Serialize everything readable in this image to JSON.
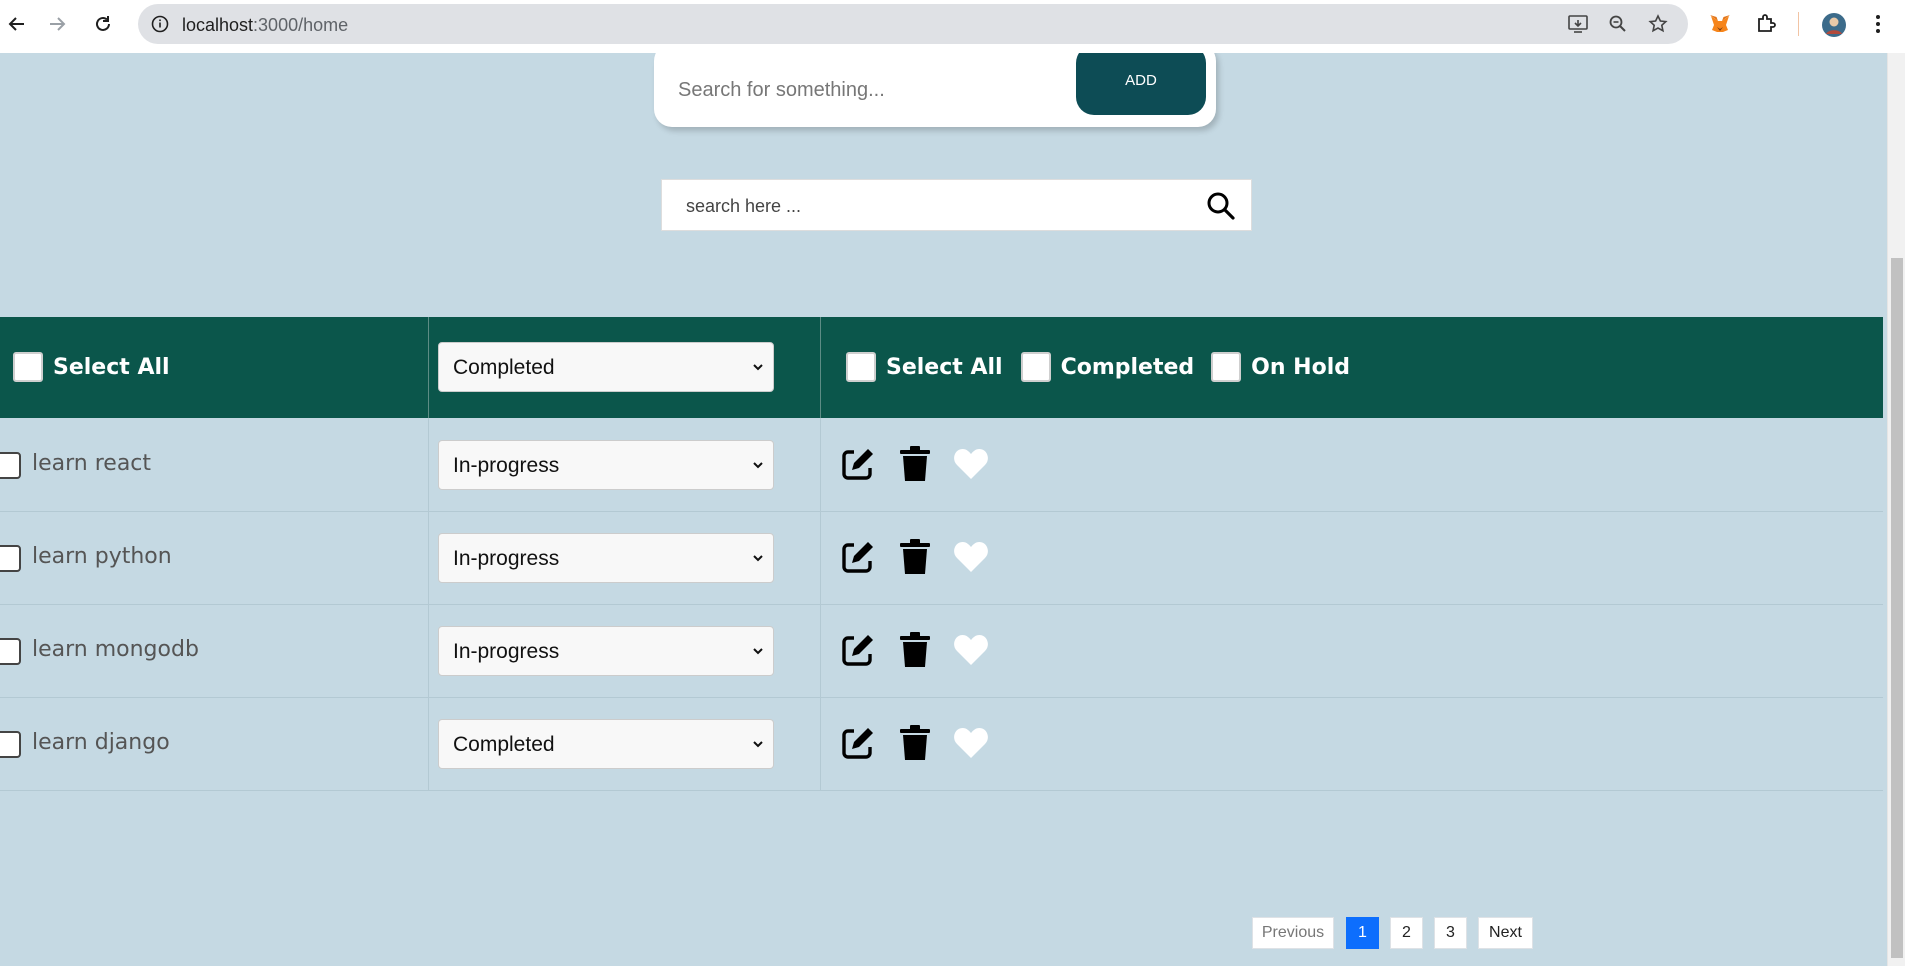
{
  "browser": {
    "url_host": "localhost",
    "url_path": ":3000/home"
  },
  "add_form": {
    "placeholder": "Search for something...",
    "button_label": "ADD"
  },
  "search": {
    "placeholder": "search here ..."
  },
  "table_header": {
    "select_all_label": "Select All",
    "filter_value": "Completed",
    "filter_options": [
      "In-progress",
      "Completed",
      "On Hold"
    ],
    "checkbox_filters": [
      {
        "label": "Select All"
      },
      {
        "label": "Completed"
      },
      {
        "label": "On Hold"
      }
    ]
  },
  "todos": [
    {
      "label": "learn react",
      "status": "In-progress"
    },
    {
      "label": "learn python",
      "status": "In-progress"
    },
    {
      "label": "learn mongodb",
      "status": "In-progress"
    },
    {
      "label": "learn django",
      "status": "Completed"
    }
  ],
  "pagination": {
    "previous_label": "Previous",
    "pages": [
      "1",
      "2",
      "3"
    ],
    "active_page": "1",
    "next_label": "Next"
  },
  "colors": {
    "page_background": "#c5d9e3",
    "header_background": "#0b564b",
    "add_button": "#0d4c55",
    "active_page": "#0d6efd"
  }
}
